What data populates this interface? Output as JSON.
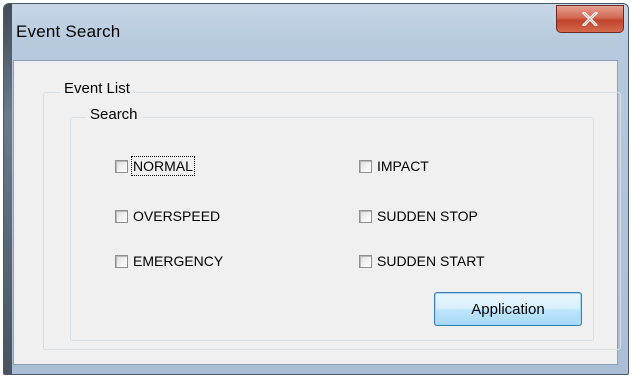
{
  "window": {
    "title": "Event Search",
    "close_icon": "close-x-icon"
  },
  "groups": {
    "outer_label": "Event List",
    "inner_label": "Search"
  },
  "checkboxes": [
    {
      "label": "NORMAL",
      "checked": false,
      "focused": true
    },
    {
      "label": "IMPACT",
      "checked": false
    },
    {
      "label": "OVERSPEED",
      "checked": false
    },
    {
      "label": "SUDDEN STOP",
      "checked": false
    },
    {
      "label": "EMERGENCY",
      "checked": false
    },
    {
      "label": "SUDDEN START",
      "checked": false
    }
  ],
  "buttons": {
    "apply_label": "Application"
  },
  "colors": {
    "close_button": "#c7432a",
    "button_border": "#3c7fb1",
    "client_bg": "#f0f0f0"
  }
}
